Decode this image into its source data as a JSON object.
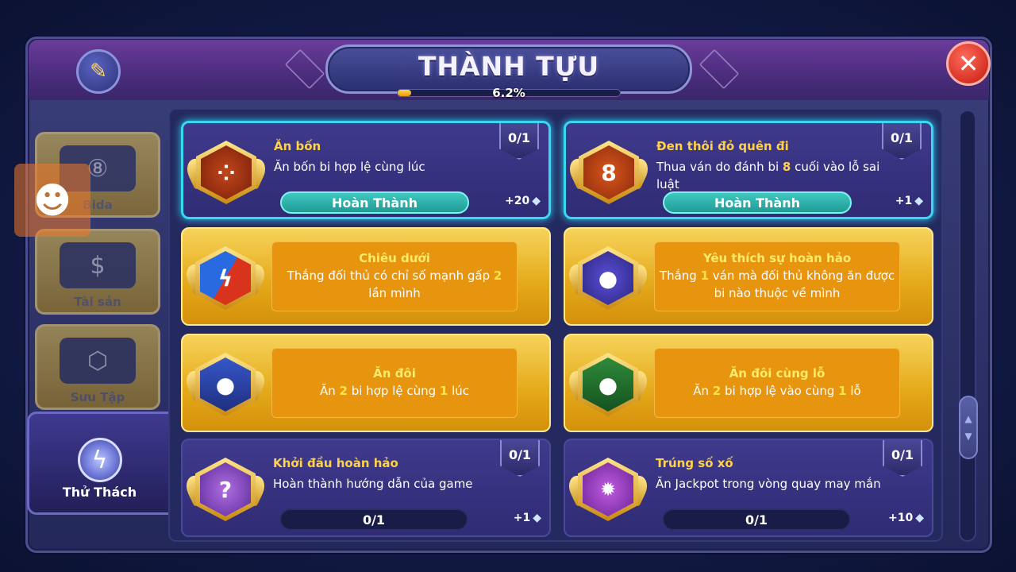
{
  "header": {
    "title": "THÀNH TỰU",
    "progress_text": "6.2%",
    "progress_value": 0.062
  },
  "sidebar": {
    "items": [
      {
        "label": "Bida",
        "icon": "billiard-8-ball-icon",
        "active": false
      },
      {
        "label": "Tài sản",
        "icon": "coins-icon",
        "active": false
      },
      {
        "label": "Sưu Tập",
        "icon": "cue-collection-icon",
        "active": false
      },
      {
        "label": "Thử Thách",
        "icon": "lightning-icon",
        "active": true
      }
    ]
  },
  "achievements": [
    {
      "title": "Ăn bốn",
      "desc": "Ăn bốn bi hợp lệ cùng lúc",
      "count": "0/1",
      "status_label": "Hoàn Thành",
      "reward": "+20",
      "icon": "four-balls-icon"
    },
    {
      "title": "Đen thôi đỏ quên đi",
      "desc_parts": [
        "Thua ván do đánh bi ",
        "8",
        " cuối vào lỗ sai luật"
      ],
      "count": "0/1",
      "status_label": "Hoàn Thành",
      "reward": "+1",
      "icon": "eight-ball-cross-icon"
    },
    {
      "title": "Chiêu dưới",
      "desc_parts": [
        "Thắng đối thủ có chỉ số mạnh gấp ",
        "2",
        " lần mình"
      ],
      "icon": "x2-shield-icon"
    },
    {
      "title": "Yêu thích sự hoàn hảo",
      "desc_parts": [
        "Thắng ",
        "1",
        " ván mà đối thủ không ăn được bi nào thuộc về mình"
      ],
      "icon": "ghost-ball-icon"
    },
    {
      "title": "Ăn đôi",
      "desc_parts": [
        "Ăn ",
        "2",
        " bi hợp lệ cùng ",
        "1",
        " lúc"
      ],
      "icon": "two-balls-table-icon"
    },
    {
      "title": "Ăn đôi cùng lỗ",
      "desc_parts": [
        "Ăn ",
        "2",
        " bi hợp lệ vào cùng ",
        "1",
        " lỗ"
      ],
      "icon": "two-balls-pocket-icon"
    },
    {
      "title": "Khởi đầu hoàn hảo",
      "desc": "Hoàn thành hướng dẫn của game",
      "count": "0/1",
      "progress_label": "0/1",
      "reward": "+1",
      "icon": "tutorial-book-icon"
    },
    {
      "title": "Trúng số xố",
      "desc": "Ăn Jackpot trong vòng quay may mắn",
      "count": "0/1",
      "progress_label": "0/1",
      "reward": "+10",
      "icon": "jackpot-wheel-icon"
    }
  ],
  "colors": {
    "done_border": "#37d9f2",
    "gold_card": "#e4a818",
    "highlight": "#ffd24a"
  }
}
